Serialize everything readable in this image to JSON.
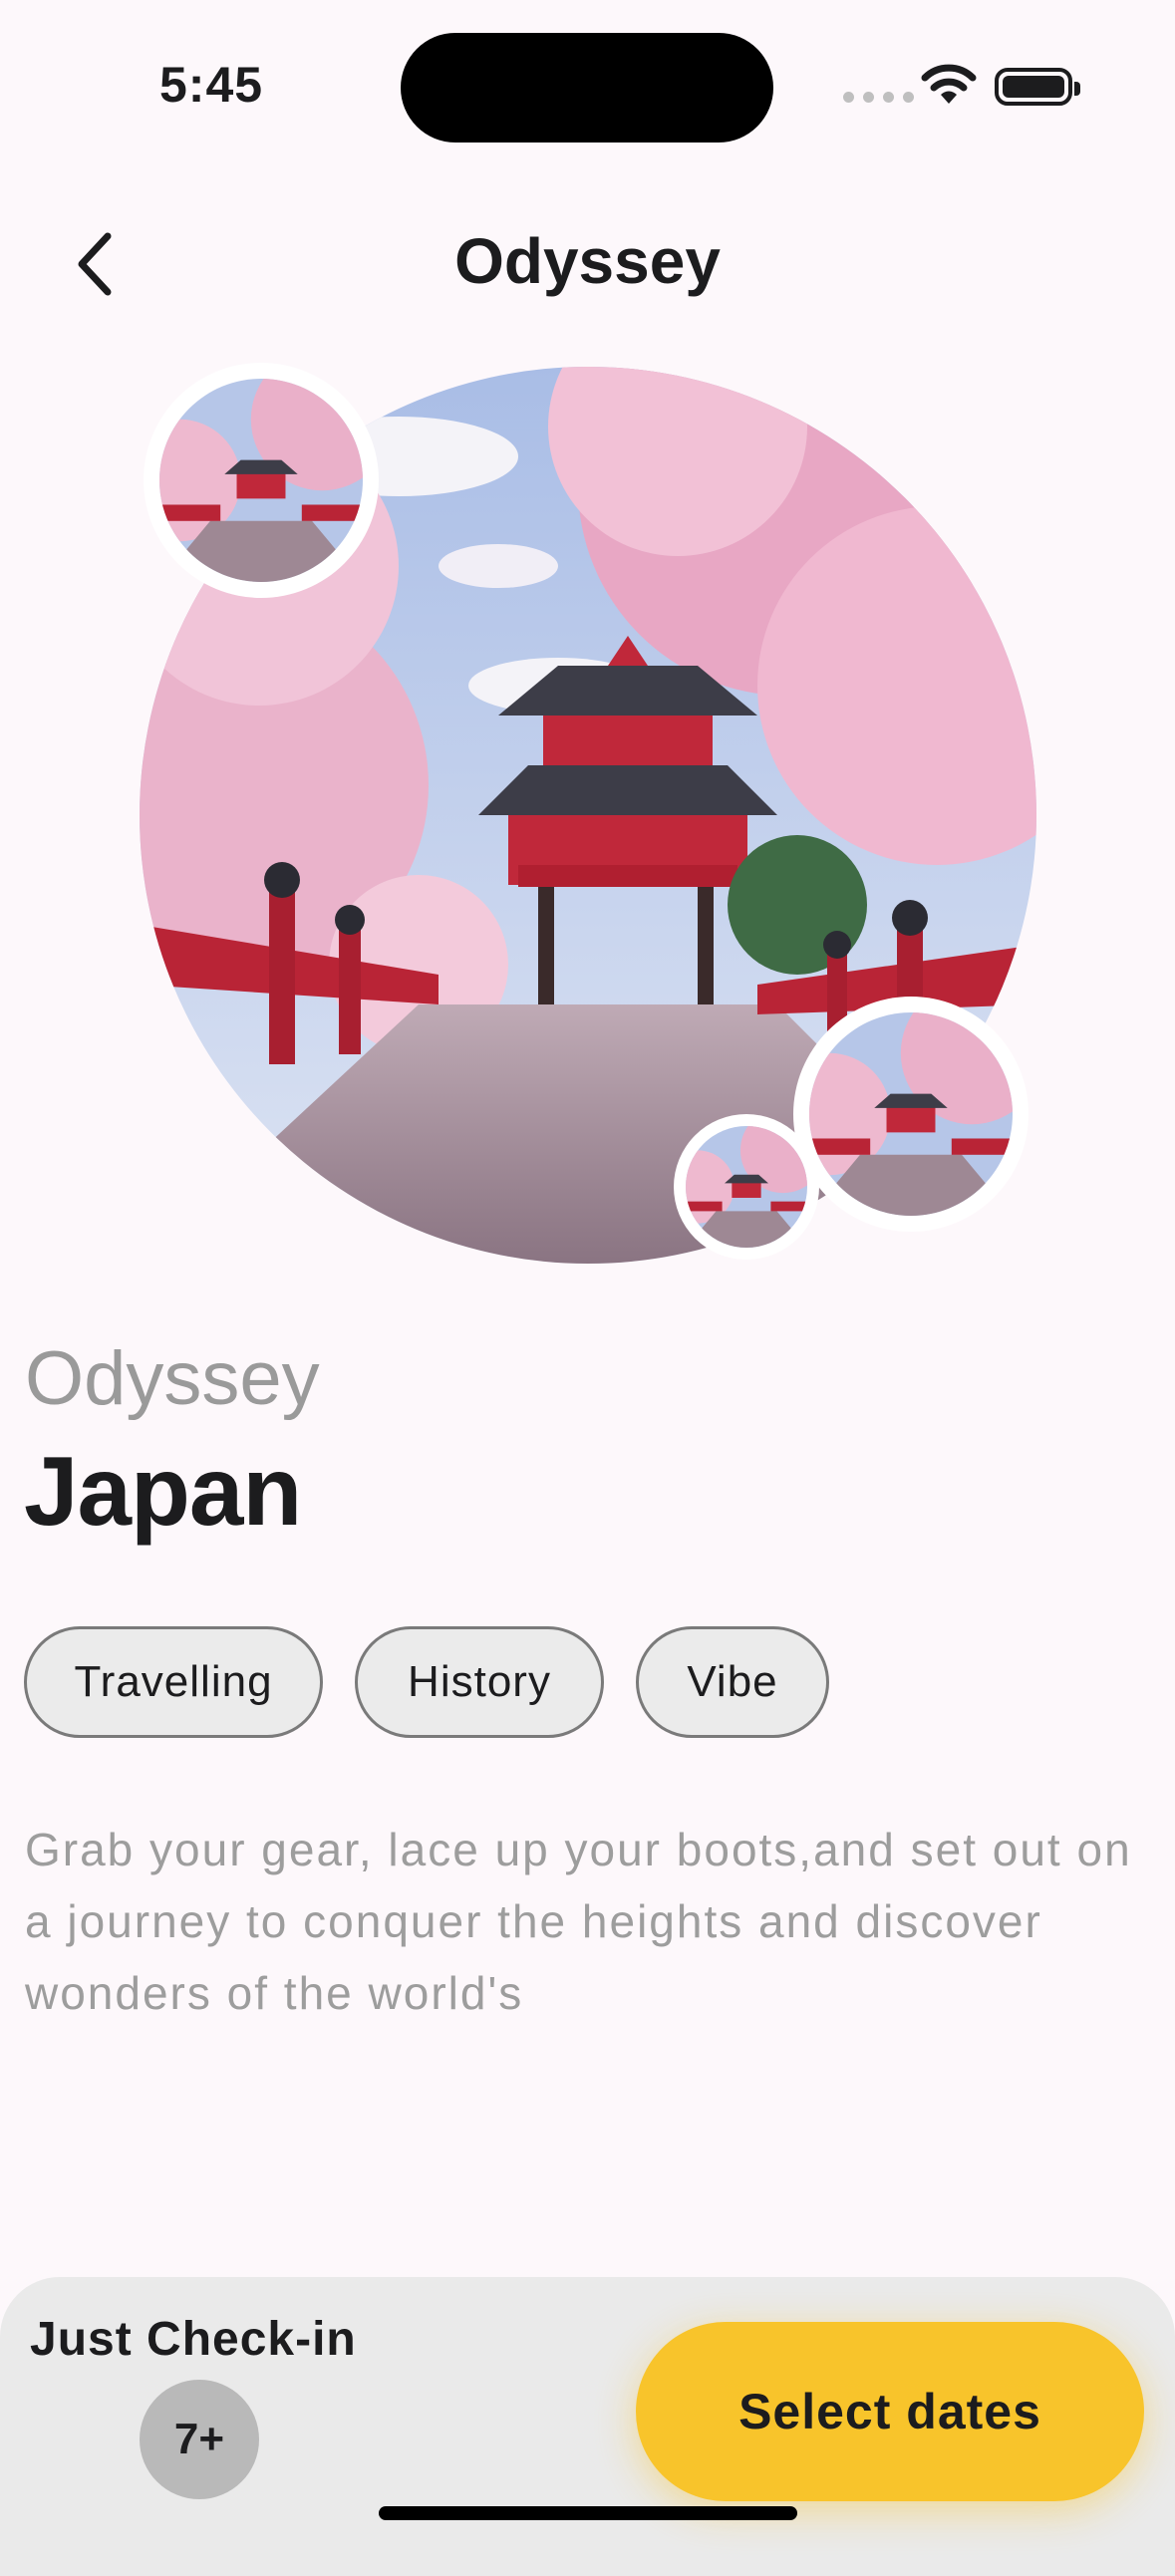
{
  "status_bar": {
    "time": "5:45"
  },
  "nav": {
    "title": "Odyssey"
  },
  "destination": {
    "kicker": "Odyssey",
    "title": "Japan"
  },
  "tags": [
    "Travelling",
    "History",
    "Vibe"
  ],
  "description": "Grab your gear, lace up your boots,and set out on a journey to conquer the heights and discover wonders of the world's",
  "footer": {
    "checkin_label": "Just Check-in",
    "checkin_count": "7+",
    "cta_label": "Select dates"
  },
  "colors": {
    "accent": "#f8c42b",
    "background": "#fdf8fb",
    "panel": "#eaeaea"
  },
  "icons": {
    "back": "chevron-left-icon",
    "wifi": "wifi-icon",
    "battery": "battery-icon"
  }
}
